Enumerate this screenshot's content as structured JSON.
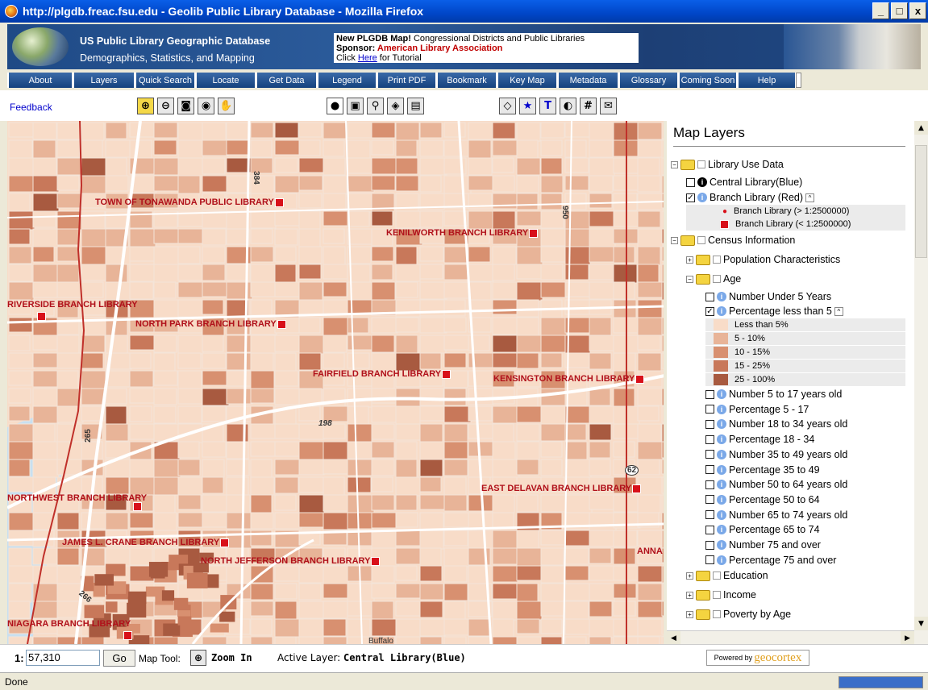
{
  "window": {
    "title": "http://plgdb.freac.fsu.edu - Geolib Public Library Database - Mozilla Firefox",
    "min": "_",
    "max": "□",
    "close": "x"
  },
  "banner": {
    "title": "US Public Library Geographic Database",
    "subtitle": "Demographics, Statistics, and Mapping",
    "news_bold": "New PLGDB Map!",
    "news_text": " Congressional Districts and Public Libraries",
    "sponsor_label": "Sponsor:",
    "sponsor_name": " American Library Association",
    "click": "Click ",
    "here": "Here",
    "tutorial": " for Tutorial"
  },
  "nav": [
    "About",
    "Layers",
    "Quick Search",
    "Locate",
    "Get Data",
    "Legend",
    "Print PDF",
    "Bookmark",
    "Key Map",
    "Metadata",
    "Glossary",
    "Coming Soon",
    "Help"
  ],
  "toolbar": {
    "feedback": "Feedback"
  },
  "map": {
    "libraries": [
      {
        "name": "TOWN OF TONAWANDA PUBLIC LIBRARY"
      },
      {
        "name": "KENILWORTH BRANCH LIBRARY"
      },
      {
        "name": "RIVERSIDE BRANCH LIBRARY"
      },
      {
        "name": "NORTH PARK BRANCH LIBRARY"
      },
      {
        "name": "FAIRFIELD BRANCH LIBRARY"
      },
      {
        "name": "KENSINGTON BRANCH LIBRARY"
      },
      {
        "name": "NORTHWEST BRANCH LIBRARY"
      },
      {
        "name": "EAST DELAVAN BRANCH LIBRARY"
      },
      {
        "name": "JAMES L. CRANE BRANCH LIBRARY"
      },
      {
        "name": "NORTH JEFFERSON BRANCH LIBRARY"
      },
      {
        "name": "NIAGARA BRANCH LIBRARY"
      },
      {
        "name": "ANNA"
      }
    ],
    "roads": [
      "384",
      "950",
      "265",
      "198",
      "266",
      "62",
      "Buffalo"
    ]
  },
  "layers": {
    "title": "Map Layers",
    "library_use": "Library Use Data",
    "central": "Central Library(Blue)",
    "branch": "Branch Library (Red)",
    "branch_legend": [
      "Branch Library (> 1:2500000)",
      "Branch Library (< 1:2500000)"
    ],
    "census": "Census Information",
    "population": "Population Characteristics",
    "age": "Age",
    "under5": "Number Under 5 Years",
    "pct5": "Percentage less than 5",
    "age_legend": [
      {
        "label": "Less than 5%",
        "color": "#f8dcc8"
      },
      {
        "label": "5 - 10%",
        "color": "#e8b498"
      },
      {
        "label": "10 - 15%",
        "color": "#d89070"
      },
      {
        "label": "15 - 25%",
        "color": "#c8785a"
      },
      {
        "label": "25 - 100%",
        "color": "#a85a40"
      }
    ],
    "items": [
      "Number 5 to 17 years old",
      "Percentage 5 - 17",
      "Number 18 to 34 years old",
      "Percentage 18 - 34",
      "Number 35 to 49 years old",
      "Percentage 35 to 49",
      "Number 50 to 64 years old",
      "Percentage 50 to 64",
      "Number 65 to 74 years old",
      "Percentage 65 to 74",
      "Number 75 and over",
      "Percentage 75 and over"
    ],
    "folders": [
      "Education",
      "Income",
      "Poverty by Age"
    ]
  },
  "bottom": {
    "scale_prefix": "1:",
    "scale_value": "57,310",
    "go": "Go",
    "map_tool_label": "Map Tool:",
    "map_tool": "Zoom In",
    "active_layer_label": "Active Layer: ",
    "active_layer": "Central Library(Blue)",
    "powered": "Powered by",
    "geocortex": "geocortex"
  },
  "status": {
    "text": "Done"
  }
}
